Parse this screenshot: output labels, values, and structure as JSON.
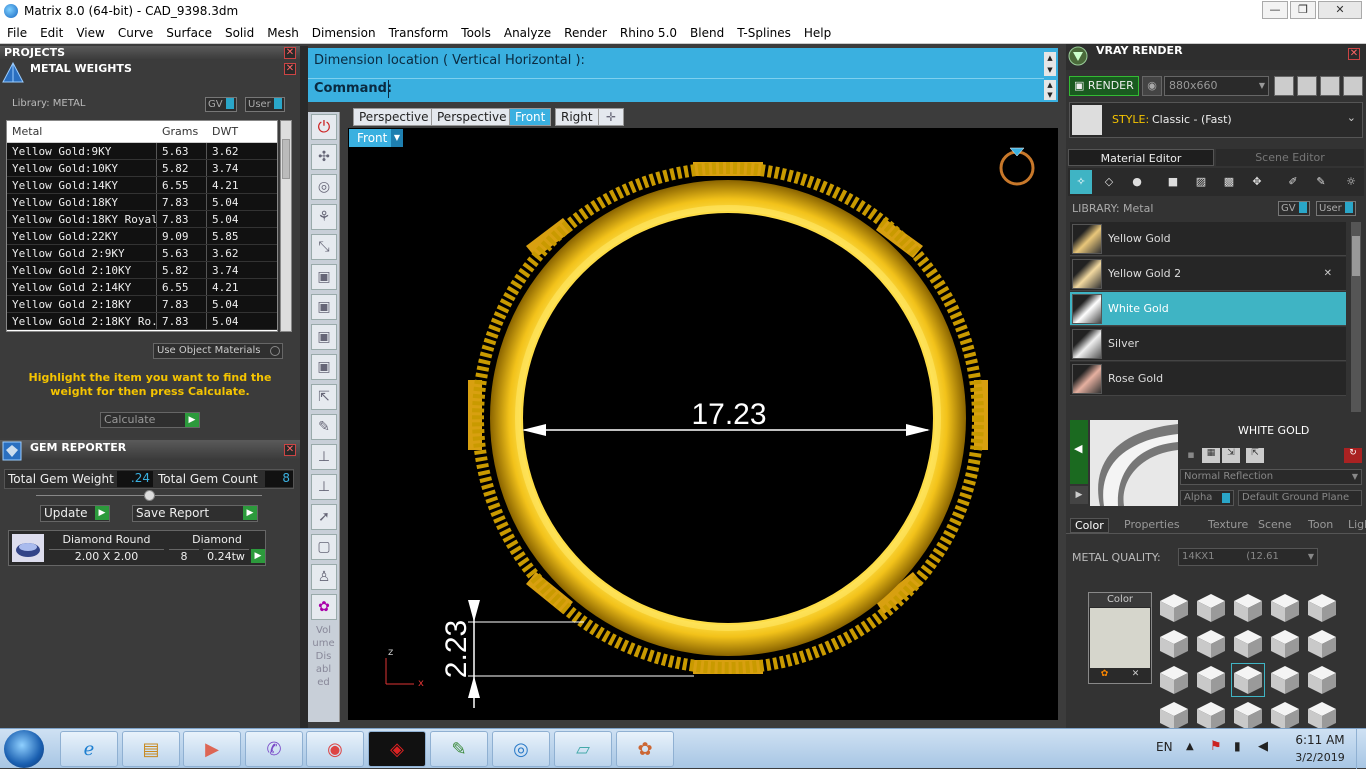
{
  "window": {
    "title": "Matrix 8.0 (64-bit) - CAD_9398.3dm"
  },
  "menu": [
    "File",
    "Edit",
    "View",
    "Curve",
    "Surface",
    "Solid",
    "Mesh",
    "Dimension",
    "Transform",
    "Tools",
    "Analyze",
    "Render",
    "Rhino 5.0",
    "Blend",
    "T-Splines",
    "Help"
  ],
  "projects": {
    "title": "PROJECTS"
  },
  "metal_weights": {
    "title": "METAL WEIGHTS",
    "library_label": "Library: METAL",
    "gv": "GV",
    "user": "User",
    "columns": [
      "Metal",
      "Grams",
      "DWT"
    ],
    "rows": [
      [
        "Yellow Gold:9KY",
        "5.63",
        "3.62"
      ],
      [
        "Yellow Gold:10KY",
        "5.82",
        "3.74"
      ],
      [
        "Yellow Gold:14KY",
        "6.55",
        "4.21"
      ],
      [
        "Yellow Gold:18KY",
        "7.83",
        "5.04"
      ],
      [
        "Yellow Gold:18KY Royal",
        "7.83",
        "5.04"
      ],
      [
        "Yellow Gold:22KY",
        "9.09",
        "5.85"
      ],
      [
        "Yellow Gold 2:9KY",
        "5.63",
        "3.62"
      ],
      [
        "Yellow Gold 2:10KY",
        "5.82",
        "3.74"
      ],
      [
        "Yellow Gold 2:14KY",
        "6.55",
        "4.21"
      ],
      [
        "Yellow Gold 2:18KY",
        "7.83",
        "5.04"
      ],
      [
        "Yellow Gold 2:18KY Ro...",
        "7.83",
        "5.04"
      ]
    ],
    "use_object_materials": "Use Object Materials",
    "hint": "Highlight the item you want to find the weight for then press Calculate.",
    "calculate": "Calculate"
  },
  "gem_reporter": {
    "title": "GEM REPORTER",
    "total_weight_label": "Total Gem Weight",
    "total_weight": ".24",
    "total_count_label": "Total Gem Count",
    "total_count": "8",
    "update": "Update",
    "save_report": "Save Report",
    "gem": {
      "shape": "Diamond Round",
      "size": "2.00 X 2.00",
      "type": "Diamond",
      "count": "8",
      "weight": "0.24tw"
    }
  },
  "command": {
    "dimension_prompt": "Dimension location ( Vertical  Horizontal ):",
    "label": "Command:"
  },
  "viewport": {
    "tabs": [
      "Perspective",
      "Perspective",
      "Front",
      "Right"
    ],
    "active_tab": "Front",
    "view_label": "Front",
    "dim_horizontal": "17.23",
    "dim_vertical": "2.23",
    "axis_z": "z",
    "axis_x": "x"
  },
  "toolbar": {
    "vol_disabled": "Vol ume Dis abl ed"
  },
  "vray": {
    "title": "VRAY RENDER",
    "render": "RENDER",
    "resolution": "880x660",
    "style_label": "STYLE:",
    "style_value": "Classic - (Fast)",
    "tab_material": "Material Editor",
    "tab_scene": "Scene Editor",
    "library": "LIBRARY: Metal",
    "gv": "GV",
    "user": "User",
    "materials": [
      "Yellow Gold",
      "Yellow Gold 2",
      "White Gold",
      "Silver",
      "Rose Gold"
    ],
    "selected_material": "White Gold",
    "preview_title": "WHITE GOLD",
    "reflection": "Normal Reflection",
    "alpha": "Alpha",
    "ground": "Default Ground Plane",
    "subtabs": [
      "Color",
      "Properties",
      "Texture",
      "Scene",
      "Toon",
      "Light"
    ],
    "metal_quality_label": "METAL QUALITY:",
    "metal_quality_value": "14KX1          (12.61",
    "color_label": "Color"
  },
  "taskbar": {
    "lang": "EN",
    "time": "6:11 AM",
    "date": "3/2/2019"
  },
  "colors": {
    "accent": "#3ab0e0",
    "gold": "#f0c020",
    "selected": "#3fb4c4"
  }
}
